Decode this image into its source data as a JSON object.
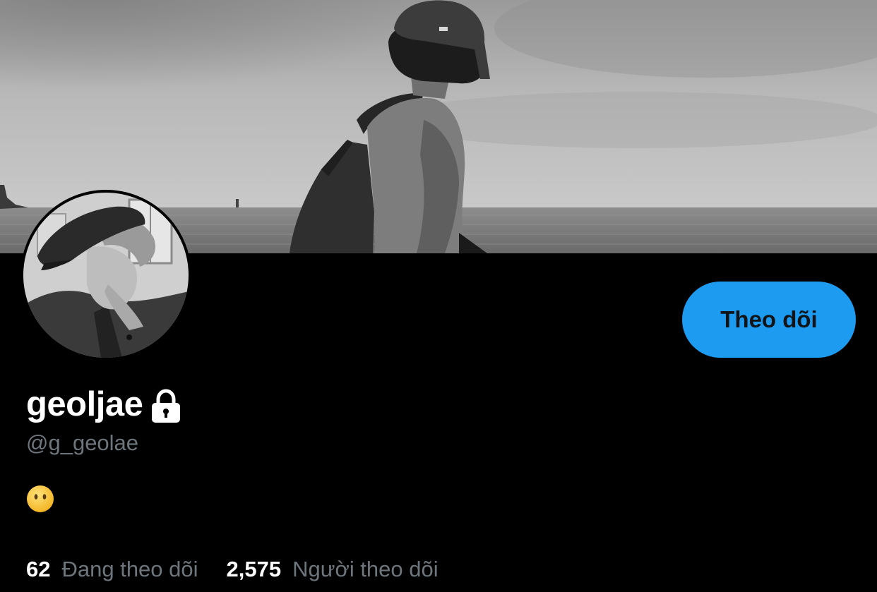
{
  "colors": {
    "background": "#000000",
    "accent": "#1d9bf0",
    "follow_button_text": "#0f1419",
    "primary_text": "#ffffff",
    "secondary_text": "#6e767d",
    "emoji_face": "#f7c236"
  },
  "profile": {
    "display_name": "geoljae",
    "protected_icon": "lock-icon",
    "handle": "@g_geolae",
    "bio_emoji": "face-without-mouth-emoji"
  },
  "actions": {
    "follow_label": "Theo dõi"
  },
  "stats": {
    "following_count": "62",
    "following_label": "Đang theo dõi",
    "followers_count": "2,575",
    "followers_label": "Người theo dõi"
  }
}
